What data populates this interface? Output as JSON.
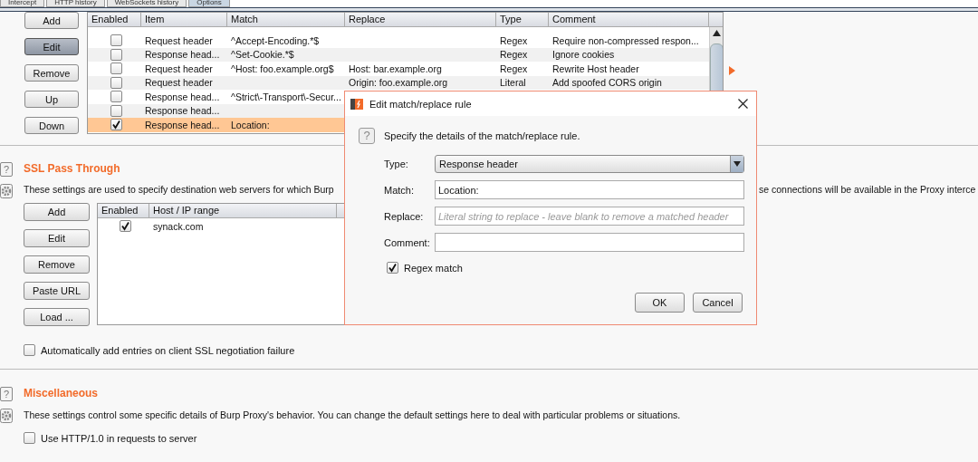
{
  "tabs": [
    {
      "label": "Intercept",
      "selected": false
    },
    {
      "label": "HTTP history",
      "selected": false
    },
    {
      "label": "WebSockets history",
      "selected": false
    },
    {
      "label": "Options",
      "selected": true
    }
  ],
  "match_replace": {
    "buttons": [
      {
        "label": "Add",
        "pressed": false
      },
      {
        "label": "Edit",
        "pressed": true
      },
      {
        "label": "Remove",
        "pressed": false
      },
      {
        "label": "Up",
        "pressed": false
      },
      {
        "label": "Down",
        "pressed": false
      }
    ],
    "table": {
      "columns": [
        "Enabled",
        "Item",
        "Match",
        "Replace",
        "Type",
        "Comment"
      ],
      "rows": [
        {
          "enabled": false,
          "selected": false,
          "item": "Request header",
          "match": "^Accept-Encoding.*$",
          "type": "Regex",
          "comment": "Require non-compressed respon..."
        },
        {
          "enabled": false,
          "selected": false,
          "item": "Response head...",
          "match": "^Set-Cookie.*$",
          "type": "Regex",
          "comment": "Ignore cookies"
        },
        {
          "enabled": false,
          "selected": false,
          "item": "Request header",
          "match": "^Host: foo.example.org$",
          "replace": "Host: bar.example.org",
          "type": "Regex",
          "comment": "Rewrite Host header"
        },
        {
          "enabled": false,
          "selected": false,
          "item": "Request header",
          "replace": "Origin: foo.example.org",
          "type": "Literal",
          "comment": "Add spoofed CORS origin"
        },
        {
          "enabled": false,
          "selected": false,
          "item": "Response head...",
          "match": "^Strict\\-Transport\\-Secur..."
        },
        {
          "enabled": false,
          "selected": false,
          "item": "Response head..."
        },
        {
          "enabled": true,
          "selected": true,
          "item": "Response head...",
          "match": "Location:"
        }
      ]
    }
  },
  "ssl_pass_through": {
    "help": "?",
    "title": "SSL Pass Through",
    "description": [
      "These settings are used to specify destination web servers for which Burp",
      "se connections will be available in the Proxy interce"
    ],
    "buttons": [
      "Add",
      "Edit",
      "Remove",
      "Paste URL",
      "Load ..."
    ],
    "table": {
      "columns": [
        "Enabled",
        "Host / IP range"
      ],
      "rows": [
        {
          "enabled": true,
          "host": "synack.com"
        }
      ]
    },
    "options": [
      {
        "label": "Automatically add entries on client SSL negotiation failure",
        "checked": false
      }
    ]
  },
  "miscellaneous": {
    "help": "?",
    "title": "Miscellaneous",
    "description": "These settings control some specific details of Burp Proxy's behavior. You can change the default settings here to deal with particular problems or situations.",
    "options": [
      {
        "label": "Use HTTP/1.0 in requests to server",
        "checked": false
      }
    ]
  },
  "dialog": {
    "title": "Edit match/replace rule",
    "help": "?",
    "intro": "Specify the details of the match/replace rule.",
    "fields": [
      {
        "kind": "select",
        "label": "Type:",
        "value": "Response header"
      },
      {
        "kind": "text",
        "label": "Match:",
        "value": "Location:"
      },
      {
        "kind": "text",
        "label": "Replace:",
        "placeholder": "Literal string to replace - leave blank to remove a matched header"
      },
      {
        "kind": "text",
        "label": "Comment:"
      }
    ],
    "regex_match": {
      "label": "Regex match",
      "checked": true
    },
    "buttons": [
      "OK",
      "Cancel"
    ]
  }
}
